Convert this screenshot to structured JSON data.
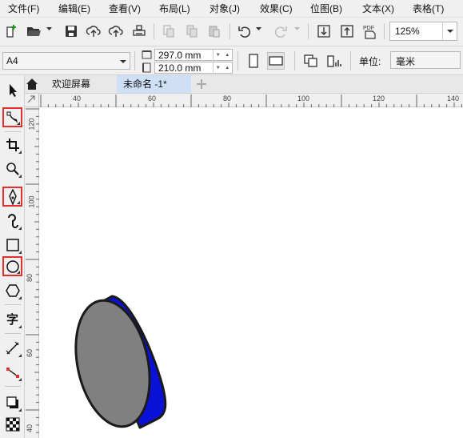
{
  "menu": {
    "items": [
      "文件(F)",
      "编辑(E)",
      "查看(V)",
      "布局(L)",
      "对象(J)",
      "效果(C)",
      "位图(B)",
      "文本(X)",
      "表格(T)"
    ]
  },
  "toolbar": {
    "zoom_value": "125%",
    "pdf_label": "PDF"
  },
  "property_bar": {
    "page_size": "A4",
    "page_width": "297.0 mm",
    "page_height": "210.0 mm",
    "unit_label": "单位:",
    "unit_value": "毫米"
  },
  "tabs": {
    "welcome": "欢迎屏幕",
    "document": "未命名 -1*"
  },
  "rulers": {
    "horizontal": [
      "40",
      "60",
      "80",
      "100",
      "120",
      "140"
    ],
    "vertical": [
      "120",
      "100",
      "80",
      "60",
      "40"
    ]
  },
  "toolbox": {
    "text_tool_glyph": "字"
  },
  "shape": {
    "face_color": "#808080",
    "side_color": "#0a12d8",
    "outline_color": "#1a1a1a"
  }
}
